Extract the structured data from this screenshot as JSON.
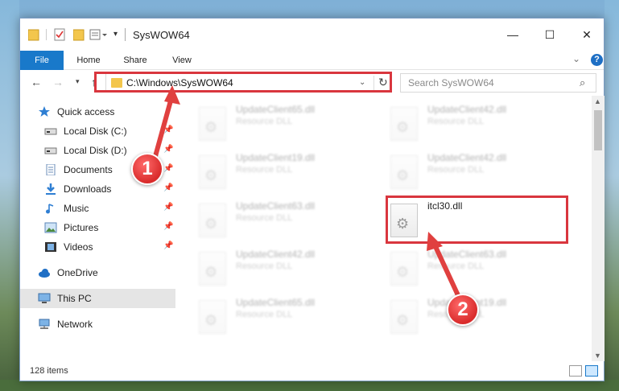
{
  "window": {
    "title": "SysWOW64",
    "controls": {
      "minimize": "—",
      "maximize": "☐",
      "close": "✕"
    }
  },
  "ribbon": {
    "tabs": [
      "File",
      "Home",
      "Share",
      "View"
    ],
    "help": "?"
  },
  "nav": {
    "address": "C:\\Windows\\SysWOW64",
    "search_placeholder": "Search SysWOW64"
  },
  "sidebar": {
    "items": [
      {
        "label": "Quick access",
        "icon": "star-icon",
        "pinned": false
      },
      {
        "label": "Local Disk (C:)",
        "icon": "drive-icon",
        "pinned": true
      },
      {
        "label": "Local Disk (D:)",
        "icon": "drive-icon",
        "pinned": true
      },
      {
        "label": "Documents",
        "icon": "documents-icon",
        "pinned": true
      },
      {
        "label": "Downloads",
        "icon": "downloads-icon",
        "pinned": true
      },
      {
        "label": "Music",
        "icon": "music-icon",
        "pinned": true
      },
      {
        "label": "Pictures",
        "icon": "pictures-icon",
        "pinned": true
      },
      {
        "label": "Videos",
        "icon": "videos-icon",
        "pinned": true
      },
      {
        "label": "OneDrive",
        "icon": "onedrive-icon",
        "pinned": false
      },
      {
        "label": "This PC",
        "icon": "this-pc-icon",
        "pinned": false
      },
      {
        "label": "Network",
        "icon": "network-icon",
        "pinned": false
      }
    ]
  },
  "files": [
    {
      "name": "UpdateClient65.dll",
      "type": "Resource DLL"
    },
    {
      "name": "UpdateClient42.dll",
      "type": "Resource DLL"
    },
    {
      "name": "UpdateClient19.dll",
      "type": "Resource DLL"
    },
    {
      "name": "UpdateClient42.dll",
      "type": "Resource DLL"
    },
    {
      "name": "UpdateClient63.dll",
      "type": "Resource DLL"
    },
    {
      "name": "itcl30.dll",
      "type": ""
    },
    {
      "name": "UpdateClient42.dll",
      "type": "Resource DLL"
    },
    {
      "name": "UpdateClient63.dll",
      "type": "Resource DLL"
    },
    {
      "name": "UpdateClient65.dll",
      "type": "Resource DLL"
    },
    {
      "name": "UpdateClient19.dll",
      "type": "Resource DLL"
    }
  ],
  "status": {
    "item_count": "128 items"
  },
  "callouts": {
    "one": "1",
    "two": "2"
  },
  "colors": {
    "accent": "#1979ca",
    "highlight": "#d9363e"
  }
}
